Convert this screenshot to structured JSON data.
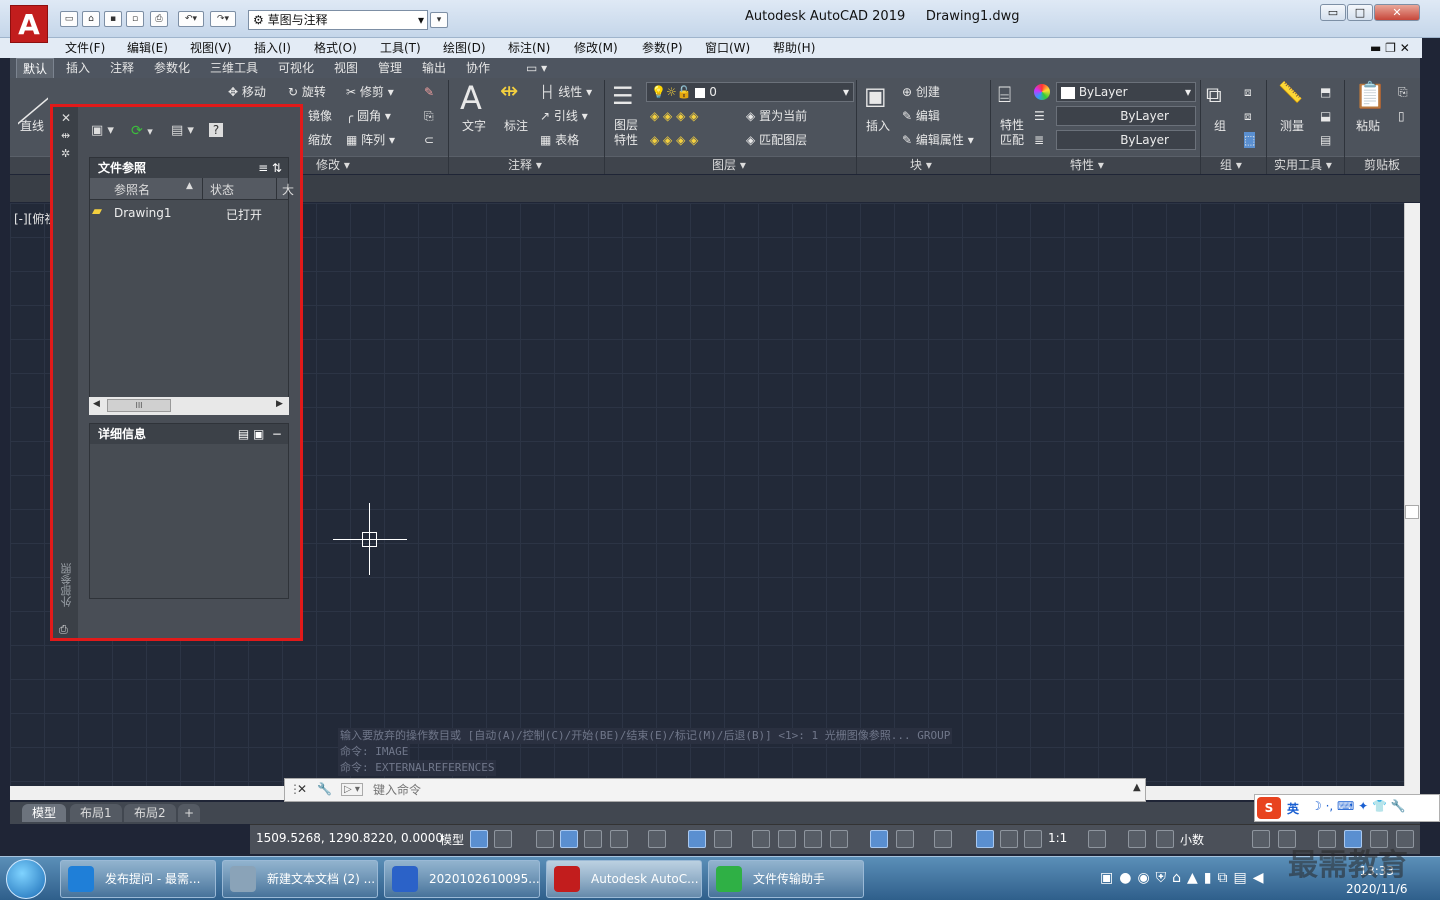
{
  "app": {
    "logo": "A",
    "title": "Autodesk AutoCAD 2019",
    "document": "Drawing1.dwg",
    "workspace": "草图与注释"
  },
  "window_buttons": {
    "minimize": "▭",
    "maximize": "□",
    "close": "✕"
  },
  "menu": [
    "文件(F)",
    "编辑(E)",
    "视图(V)",
    "插入(I)",
    "格式(O)",
    "工具(T)",
    "绘图(D)",
    "标注(N)",
    "修改(M)",
    "参数(P)",
    "窗口(W)",
    "帮助(H)"
  ],
  "ribbon_tabs": [
    "默认",
    "插入",
    "注释",
    "参数化",
    "三维工具",
    "可视化",
    "视图",
    "管理",
    "输出",
    "协作"
  ],
  "ribbon": {
    "draw": {
      "line": "直线"
    },
    "modify": {
      "move": "移动",
      "rotate": "旋转",
      "trim": "修剪",
      "mirror": "镜像",
      "fillet": "圆角",
      "scale": "缩放",
      "array": "阵列",
      "title": "修改 ▾"
    },
    "annotation": {
      "text": "文字",
      "dim": "标注",
      "linear": "线性",
      "leader": "引线",
      "table": "表格",
      "title": "注释 ▾"
    },
    "layers": {
      "props1": "图层",
      "props2": "特性",
      "current_layer": "0",
      "make_current": "置为当前",
      "match_layer": "匹配图层",
      "title": "图层 ▾"
    },
    "block": {
      "insert": "插入",
      "create": "创建",
      "edit": "编辑",
      "edit_attr": "编辑属性",
      "title": "块 ▾"
    },
    "properties": {
      "match1": "特性",
      "match2": "匹配",
      "color": "ByLayer",
      "linetype": "ByLayer",
      "lineweight": "ByLayer",
      "title": "特性 ▾"
    },
    "groups": {
      "group": "组",
      "title": "组 ▾"
    },
    "utilities": {
      "measure": "测量",
      "title": "实用工具 ▾"
    },
    "clipboard": {
      "paste": "粘贴",
      "title": "剪贴板"
    }
  },
  "viewport_label": "[-][俯视",
  "xref_palette": {
    "side_title": "外部参照",
    "file_refs_title": "文件参照",
    "columns": [
      "参照名",
      "状态",
      "大"
    ],
    "rows": [
      {
        "name": "Drawing1",
        "status": "已打开"
      }
    ],
    "scroll_thumb": "III",
    "details_title": "详细信息"
  },
  "command_history": [
    "输入要放弃的操作数目或 [自动(A)/控制(C)/开始(BE)/结束(E)/标记(M)/后退(B)] <1>: 1 光栅图像参照... GROUP",
    "命令: IMAGE",
    "命令: EXTERNALREFERENCES"
  ],
  "command_input": {
    "placeholder": "键入命令"
  },
  "layout_tabs": [
    "模型",
    "布局1",
    "布局2",
    "+"
  ],
  "status": {
    "coords": "1509.5268, 1290.8220, 0.0000",
    "model": "模型",
    "scale": "1:1",
    "units": "小数"
  },
  "ime": {
    "lang": "英"
  },
  "taskbar": [
    {
      "label": "发布提问 - 最需...",
      "color": "#1f7fd8"
    },
    {
      "label": "新建文本文档 (2) ...",
      "color": "#8aa3b8"
    },
    {
      "label": "2020102610095...",
      "color": "#2b62c8"
    },
    {
      "label": "Autodesk AutoC...",
      "color": "#c21d1d"
    },
    {
      "label": "文件传输助手",
      "color": "#2fb045"
    }
  ],
  "clock": {
    "time": "13:33",
    "date": "2020/11/6"
  },
  "watermark": "最需教育",
  "colors": {
    "canvas": "#222938",
    "ribbon": "#4d535c",
    "highlight_border": "#e11a1a",
    "taskbar": "#2f5f8b"
  }
}
